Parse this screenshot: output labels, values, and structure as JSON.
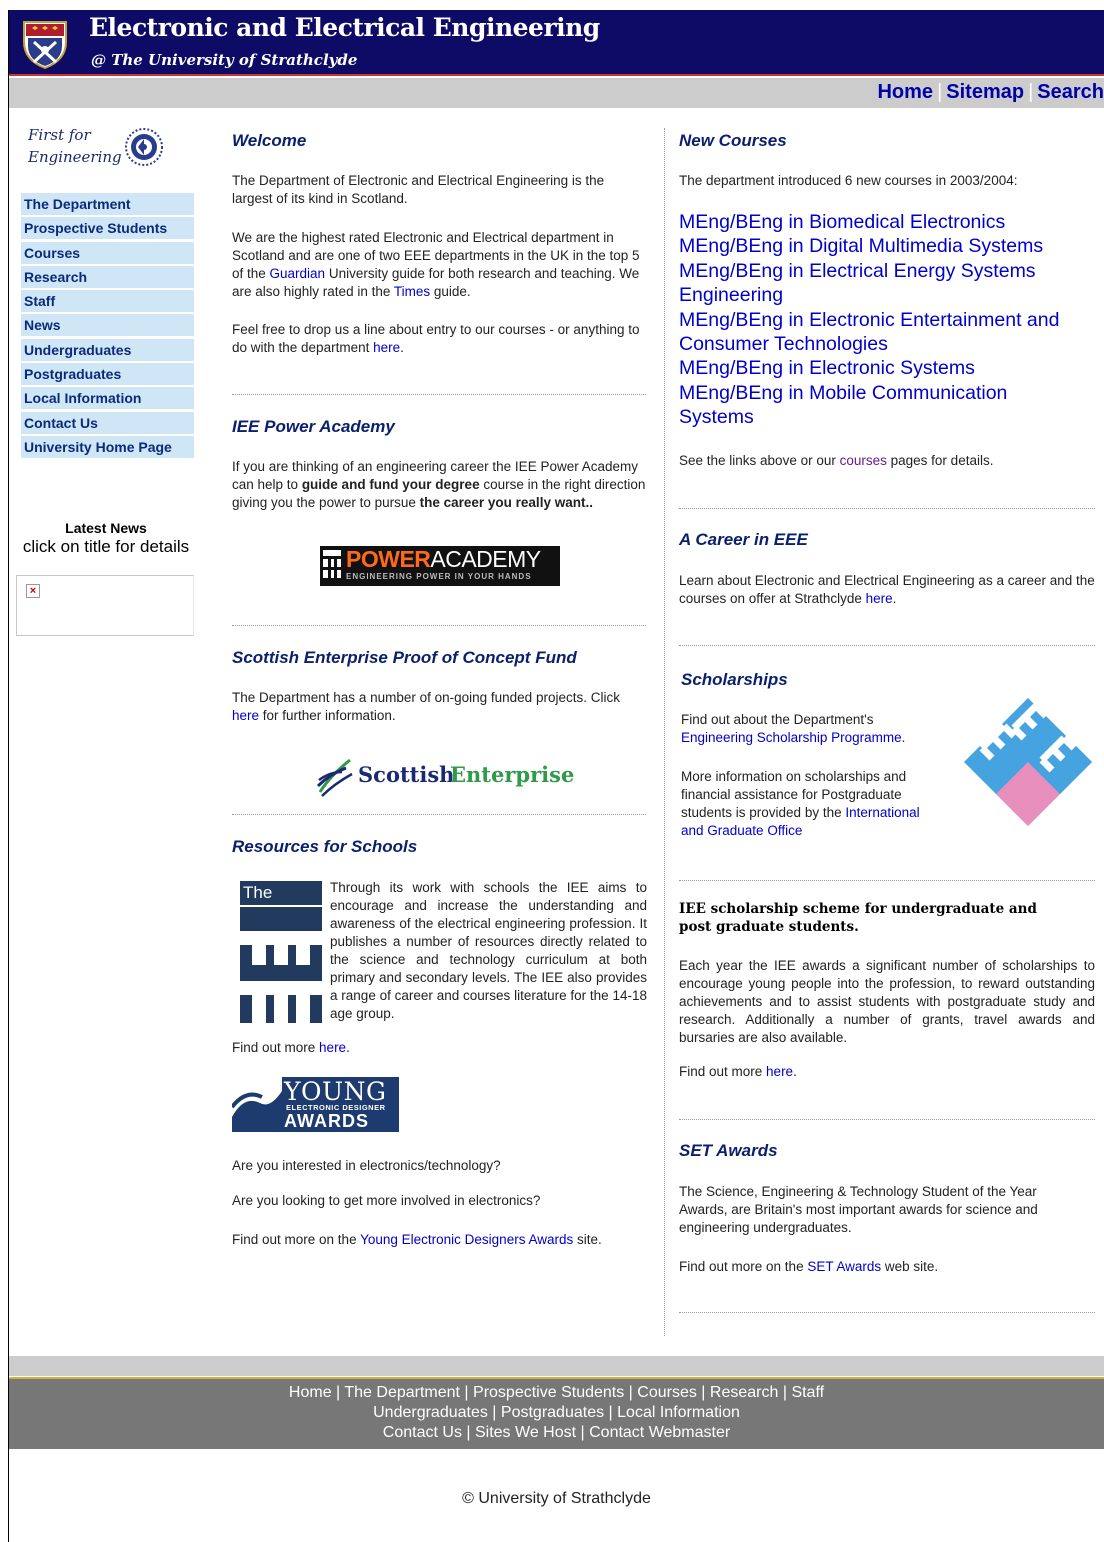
{
  "header": {
    "title": "Electronic and Electrical Engineering",
    "subtitle": "@ The University of Strathclyde",
    "colors": {
      "bar": "#0d0b66",
      "accent_line": "#cc3333"
    }
  },
  "topnav": {
    "home": "Home",
    "sitemap": "Sitemap",
    "search": "Search",
    "separator": "|"
  },
  "sidebar": {
    "logo_line1": "First for",
    "logo_line2": "Engineering",
    "items": [
      "The Department",
      "Prospective Students",
      "Courses",
      "Research",
      "Staff",
      "News",
      "Undergraduates",
      "Postgraduates",
      "Local Information",
      "Contact Us",
      "University Home Page"
    ],
    "latest_news_title": "Latest News",
    "latest_news_sub": "click on title for details"
  },
  "welcome": {
    "title": "Welcome",
    "p1": "The Department of Electronic and Electrical Engineering is the largest of its kind in Scotland.",
    "p2_a": "We are the highest rated Electronic and Electrical department in Scotland and are one of two EEE departments in the UK in the top 5 of the ",
    "p2_link1": "Guardian",
    "p2_b": " University guide for both research and teaching. We are also highly rated in the ",
    "p2_link2": "Times",
    "p2_c": " guide.",
    "p3_a": "Feel free to drop us a line about entry to our courses - or anything to do with the department ",
    "p3_link": "here",
    "p3_b": "."
  },
  "power_academy": {
    "title": "IEE Power Academy",
    "p_a": "If you are thinking of an engineering career the IEE Power Academy can help to ",
    "p_bold1": "guide and fund your degree",
    "p_b": " course in the right direction giving you the power to pursue ",
    "p_bold2": "the career you really want..",
    "logo_power": "POWER",
    "logo_academy": "ACADEMY",
    "logo_tagline": "ENGINEERING POWER IN YOUR HANDS"
  },
  "scottish_enterprise": {
    "title": "Scottish Enterprise Proof of Concept Fund",
    "p_a": "The Department has a number of on-going funded projects. Click ",
    "p_link": "here",
    "p_b": " for further information.",
    "logo_word1": "Scottish",
    "logo_word2": "Enterprise"
  },
  "schools": {
    "title": "Resources for Schools",
    "logo_the": "The",
    "p1": "Through its work with schools the IEE aims to encourage and increase the understanding and awareness of the electrical engineering profession. It publishes a number of resources directly related to the science and technology curriculum at both primary and secondary levels. The IEE also provides a range of career and courses literature for the 14-18 age group.",
    "find_more_a": "Find out more ",
    "find_more_link": "here",
    "find_more_b": ".",
    "yeda_line1": "YOUNG",
    "yeda_line2": "ELECTRONIC DESIGNER",
    "yeda_line3": "AWARDS",
    "q1": "Are you interested in electronics/technology?",
    "q2": "Are you looking to get more involved in electronics?",
    "yeda_more_a": "Find out more on the ",
    "yeda_more_link": "Young Electronic Designers Awards",
    "yeda_more_b": " site."
  },
  "new_courses": {
    "title": "New Courses",
    "intro": "The department introduced 6 new courses in  2003/2004:",
    "courses": [
      "MEng/BEng in Biomedical Electronics",
      "MEng/BEng in Digital Multimedia Systems",
      "MEng/BEng in Electrical Energy Systems Engineering",
      "MEng/BEng in Electronic Entertainment and Consumer Technologies",
      "MEng/BEng in Electronic Systems",
      "MEng/BEng in Mobile Communication Systems"
    ],
    "see_a": "See the links above or our ",
    "see_link": "courses",
    "see_b": " pages for details."
  },
  "career": {
    "title": "A Career in EEE",
    "p_a": "Learn about Electronic and Electrical Engineering as a career and the courses on offer at Strathclyde ",
    "p_link": "here",
    "p_b": "."
  },
  "scholarships": {
    "title": "Scholarships",
    "p1_a": "Find out about the Department's ",
    "p1_link": "Engineering Scholarship Programme",
    "p1_b": ".",
    "p2_a": "More information on scholarships and financial assistance for Postgraduate students is provided by the ",
    "p2_link": "International and Graduate Office",
    "iee_heading": "IEE scholarship scheme for undergraduate and post graduate students.",
    "iee_p": "Each year the IEE awards a significant number of scholarships to encourage young people into the profession, to reward outstanding achievements and to assist students with postgraduate study and research. Additionally a number of grants, travel awards and bursaries are also available.",
    "find_more_a": "Find out more ",
    "find_more_link": "here",
    "find_more_b": "."
  },
  "set_awards": {
    "title": "SET Awards",
    "p1": "The Science, Engineering & Technology Student of the Year Awards, are Britain's most important awards for science and engineering undergraduates.",
    "p2_a": "Find out more on the ",
    "p2_link": "SET Awards",
    "p2_b": " web site."
  },
  "footer": {
    "line1": [
      "Home",
      "The Department",
      "Prospective Students",
      "Courses",
      "Research",
      "Staff"
    ],
    "line2": [
      "Undergraduates",
      "Postgraduates",
      "Local Information"
    ],
    "line3": [
      "Contact Us",
      "Sites We Host",
      "Contact Webmaster"
    ],
    "separator": " | ",
    "copyright": "© University of Strathclyde"
  }
}
